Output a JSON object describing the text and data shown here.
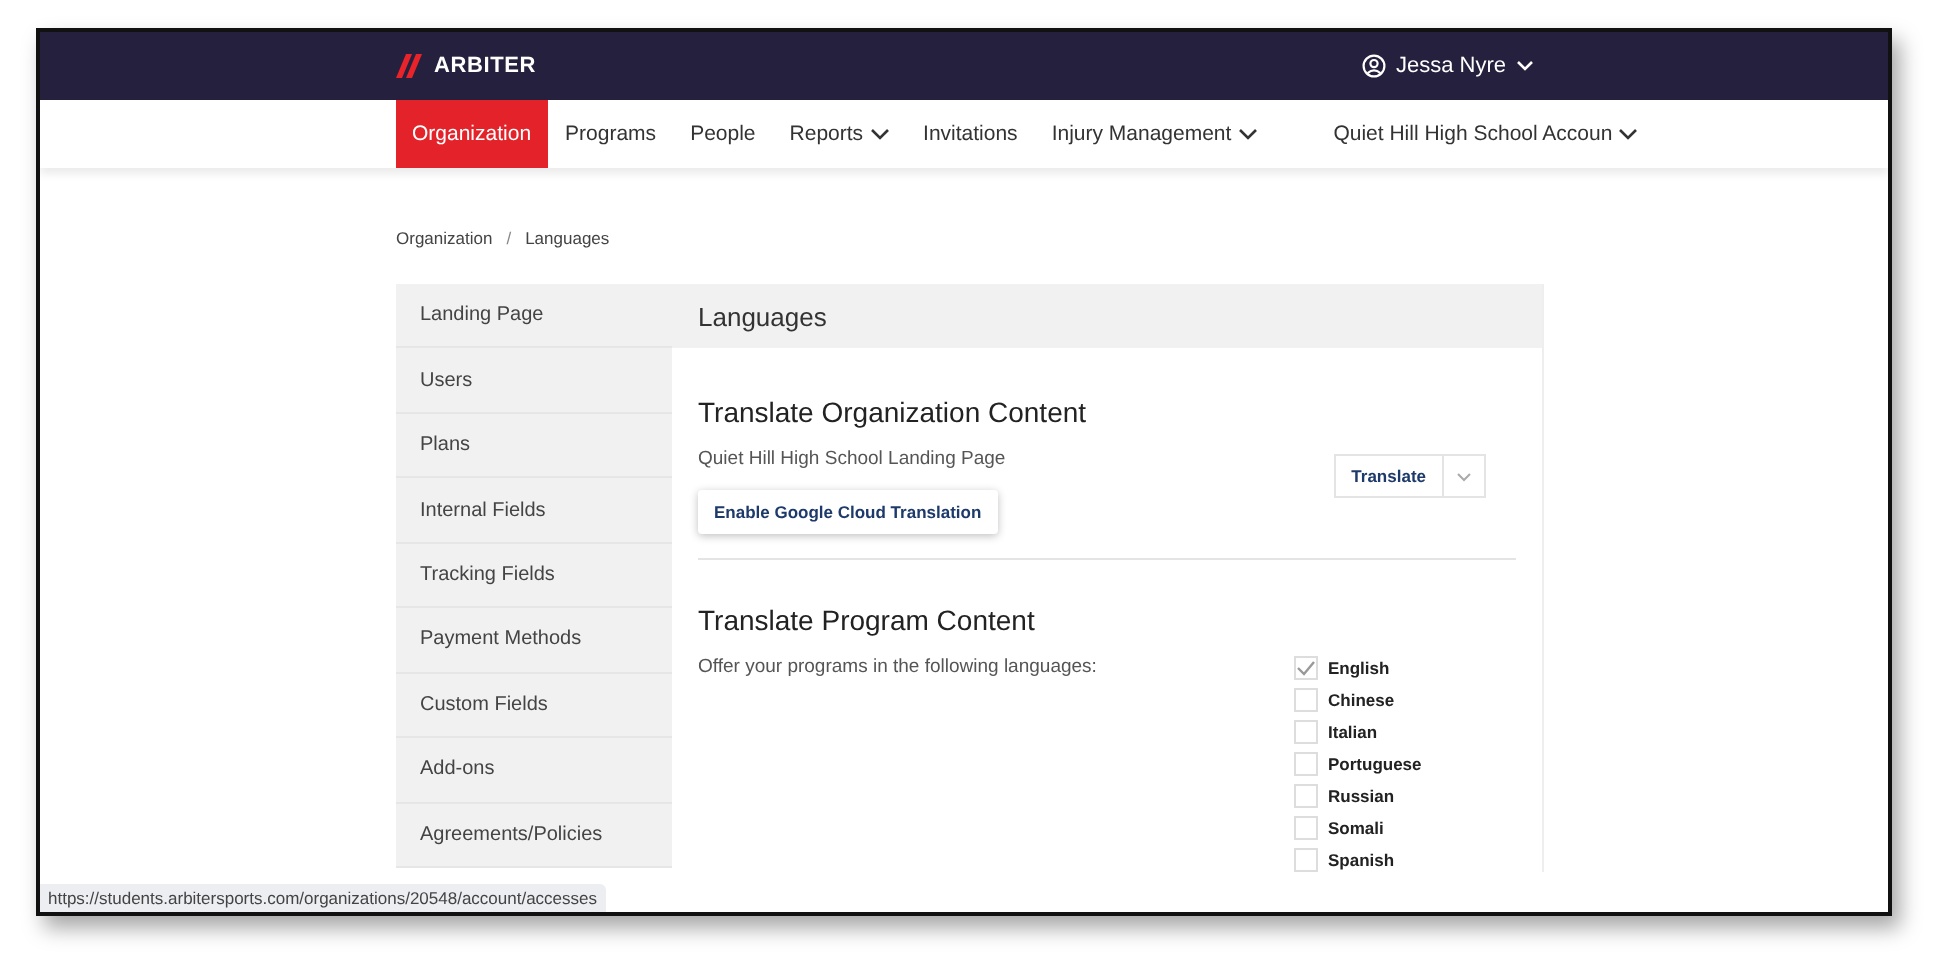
{
  "header": {
    "brand": "ARBITER",
    "user": "Jessa Nyre"
  },
  "nav": [
    {
      "label": "Organization",
      "selected": true,
      "dropdown": false
    },
    {
      "label": "Programs",
      "selected": false,
      "dropdown": false
    },
    {
      "label": "People",
      "selected": false,
      "dropdown": false
    },
    {
      "label": "Reports",
      "selected": false,
      "dropdown": true
    },
    {
      "label": "Invitations",
      "selected": false,
      "dropdown": false
    },
    {
      "label": "Injury Management",
      "selected": false,
      "dropdown": true
    },
    {
      "label": "Quiet Hill High School Accoun",
      "selected": false,
      "dropdown": true
    }
  ],
  "breadcrumb": {
    "items": [
      "Organization",
      "Languages"
    ],
    "separator": "/"
  },
  "sidebar": {
    "items": [
      "Landing Page",
      "Users",
      "Plans",
      "Internal Fields",
      "Tracking Fields",
      "Payment Methods",
      "Custom Fields",
      "Add-ons",
      "Agreements/Policies"
    ]
  },
  "panel": {
    "title": "Languages",
    "org_section": {
      "heading": "Translate Organization Content",
      "page_name": "Quiet Hill High School Landing Page",
      "enable_button": "Enable Google Cloud Translation",
      "translate_button": "Translate"
    },
    "program_section": {
      "heading": "Translate Program Content",
      "description": "Offer your programs in the following languages:",
      "languages": [
        {
          "label": "English",
          "checked": true
        },
        {
          "label": "Chinese",
          "checked": false
        },
        {
          "label": "Italian",
          "checked": false
        },
        {
          "label": "Portuguese",
          "checked": false
        },
        {
          "label": "Russian",
          "checked": false
        },
        {
          "label": "Somali",
          "checked": false
        },
        {
          "label": "Spanish",
          "checked": false
        }
      ]
    }
  },
  "status_bar": {
    "url": "https://students.arbitersports.com/organizations/20548/account/accesses"
  }
}
